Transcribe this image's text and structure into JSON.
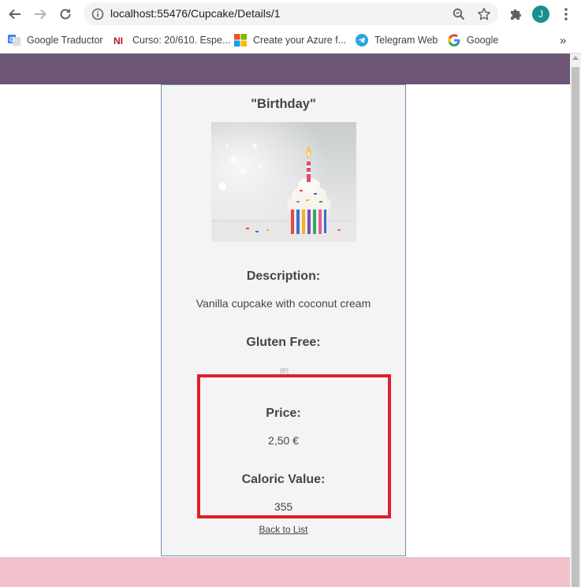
{
  "browser": {
    "url": "localhost:55476/Cupcake/Details/1",
    "profile_initial": "J",
    "bookmarks": [
      {
        "label": "Google Traductor",
        "icon": "google-translate-icon"
      },
      {
        "label": "Curso: 20/610. Espe...",
        "icon": "ni-icon"
      },
      {
        "label": "Create your Azure f...",
        "icon": "microsoft-icon"
      },
      {
        "label": "Telegram Web",
        "icon": "telegram-icon"
      },
      {
        "label": "Google",
        "icon": "google-icon"
      }
    ],
    "more_bookmarks": "»"
  },
  "colors": {
    "header": "#6d5575",
    "footer": "#f2c1cc",
    "card": "#f4f4f4",
    "highlight": "#e01e2a",
    "avatar": "#1a8f8f"
  },
  "details": {
    "name": "\"Birthday\"",
    "description_label": "Description:",
    "description": "Vanilla cupcake with coconut cream",
    "gluten_free_label": "Gluten Free:",
    "gluten_free_checked": true,
    "price_label": "Price:",
    "price": "2,50 €",
    "caloric_label": "Caloric Value:",
    "caloric_value": "355",
    "back_link": "Back to List"
  }
}
